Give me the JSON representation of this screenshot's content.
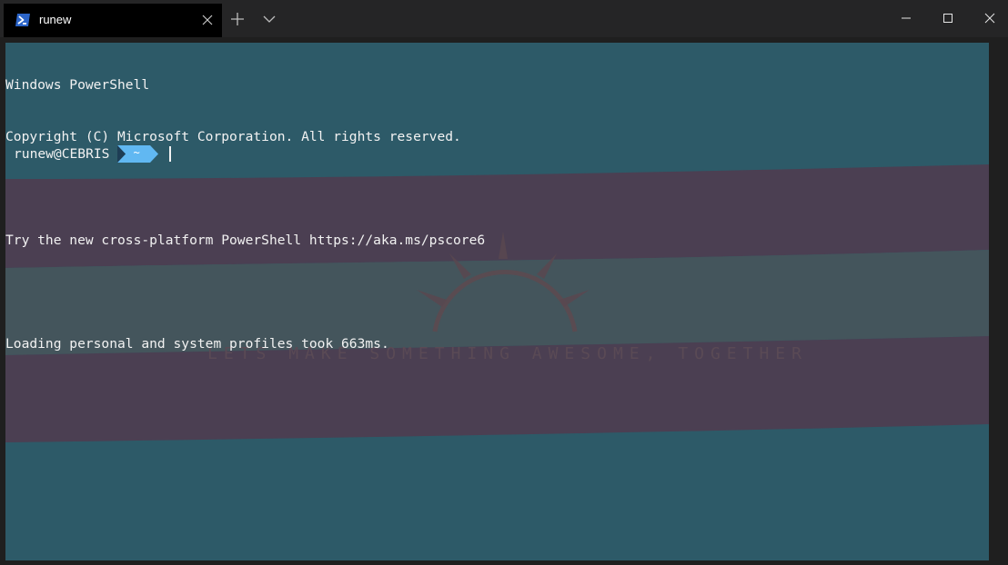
{
  "window": {
    "tab": {
      "title": "runew",
      "icon": "powershell-icon"
    },
    "controls": [
      "new-tab-icon",
      "chevron-down-icon",
      "minimize-icon",
      "maximize-icon",
      "close-icon"
    ]
  },
  "terminal": {
    "lines": [
      "Windows PowerShell",
      "Copyright (C) Microsoft Corporation. All rights reserved.",
      "",
      "Try the new cross-platform PowerShell https://aka.ms/pscore6",
      "",
      "Loading personal and system profiles took 663ms."
    ],
    "prompt": {
      "user_host": "runew@CEBRIS",
      "path": "~"
    },
    "background": {
      "watermark_text": "LETS MAKE SOMETHING AWESOME, TOGETHER",
      "stripe_colors": [
        "#2d5a68",
        "#4b3f52",
        "#44555c",
        "#4b3f52",
        "#2d5a68"
      ]
    }
  },
  "colors": {
    "titlebar": "#252526",
    "tab": "#000000",
    "foreground": "#f2f2f2",
    "prompt_segment": "#61b8f2",
    "prompt_segment_dark": "#3a86c8",
    "accent": "#0078d4"
  }
}
